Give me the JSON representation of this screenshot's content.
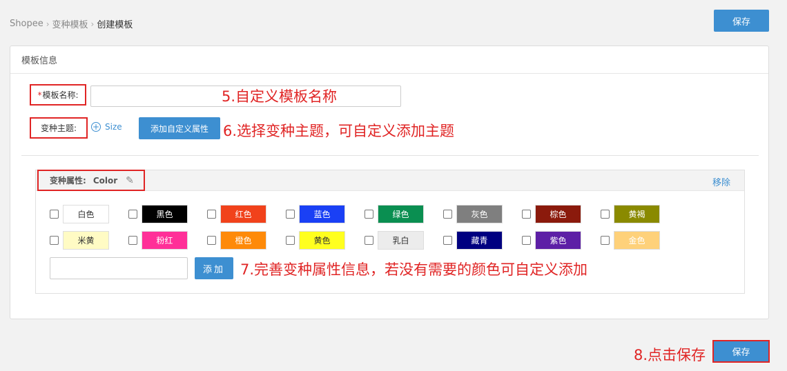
{
  "breadcrumb": {
    "items": [
      "Shopee",
      "变种模板",
      "创建模板"
    ]
  },
  "header": {
    "save_label": "保存"
  },
  "panel": {
    "title": "模板信息"
  },
  "form": {
    "name_label_star": "*",
    "name_label": "模板名称:",
    "name_value": "",
    "theme_label": "变种主题:",
    "size_label": "Size",
    "add_custom_attr_label": "添加自定义属性"
  },
  "variant": {
    "attr_label": "变种属性:",
    "attr_value": "Color",
    "remove_label": "移除",
    "colors": [
      [
        {
          "name": "白色",
          "bg": "#ffffff",
          "fg": "#333333"
        },
        {
          "name": "黑色",
          "bg": "#000000",
          "fg": "#ffffff"
        },
        {
          "name": "红色",
          "bg": "#f1421b",
          "fg": "#ffffff"
        },
        {
          "name": "蓝色",
          "bg": "#1a40f5",
          "fg": "#ffffff"
        },
        {
          "name": "绿色",
          "bg": "#0a8f51",
          "fg": "#ffffff"
        },
        {
          "name": "灰色",
          "bg": "#7f7f7f",
          "fg": "#ffffff"
        },
        {
          "name": "棕色",
          "bg": "#8b1a0c",
          "fg": "#ffffff"
        },
        {
          "name": "黄褐",
          "bg": "#8a8a00",
          "fg": "#ffffff"
        }
      ],
      [
        {
          "name": "米黄",
          "bg": "#fffbc4",
          "fg": "#333333"
        },
        {
          "name": "粉红",
          "bg": "#ff2f98",
          "fg": "#ffffff"
        },
        {
          "name": "橙色",
          "bg": "#fe8a09",
          "fg": "#ffffff"
        },
        {
          "name": "黄色",
          "bg": "#ffff1f",
          "fg": "#333333"
        },
        {
          "name": "乳白",
          "bg": "#ececec",
          "fg": "#333333"
        },
        {
          "name": "藏青",
          "bg": "#000080",
          "fg": "#ffffff"
        },
        {
          "name": "紫色",
          "bg": "#5d1fa6",
          "fg": "#ffffff"
        },
        {
          "name": "金色",
          "bg": "#fed17a",
          "fg": "#ffffff"
        }
      ]
    ],
    "custom_value": "",
    "add_label": "添加"
  },
  "annotations": {
    "step5": "5.自定义模板名称",
    "step6": "6.选择变种主题，可自定义添加主题",
    "step7": "7.完善变种属性信息，若没有需要的颜色可自定义添加",
    "step8": "8.点击保存"
  },
  "footer": {
    "save_label": "保存"
  },
  "colors": {
    "accent": "#3d8fd1",
    "highlight": "#e02424"
  }
}
